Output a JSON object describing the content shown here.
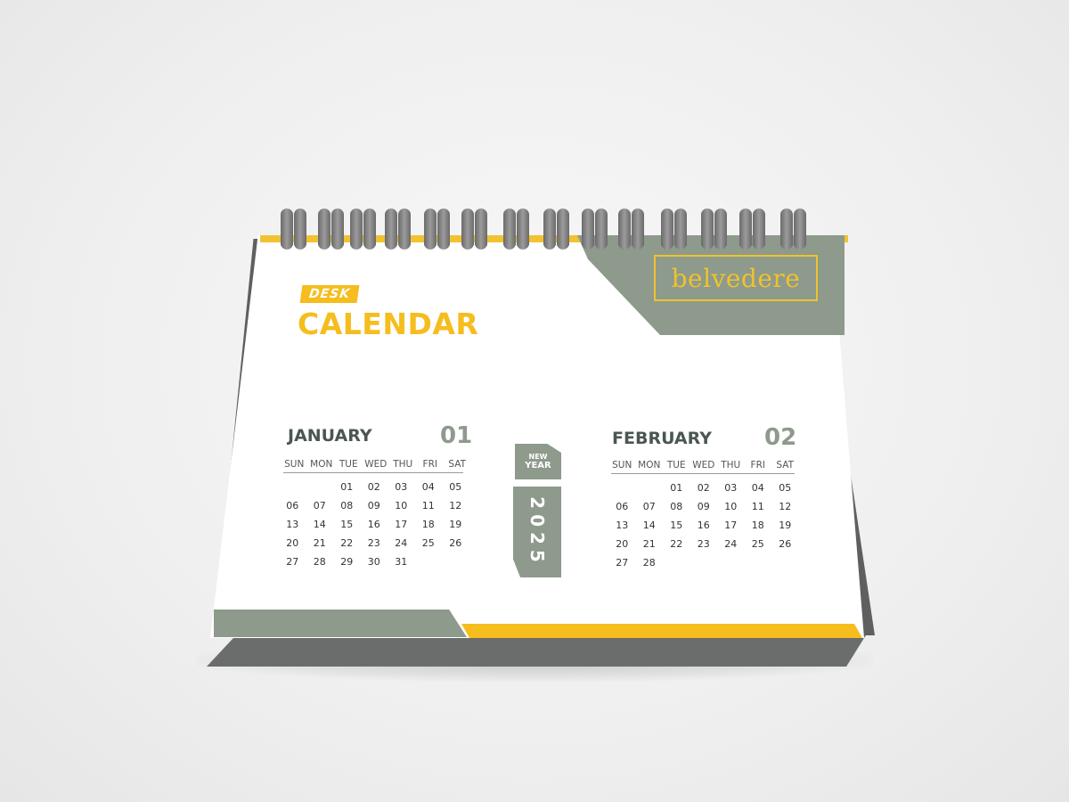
{
  "brand": {
    "logo_text": "belvedere"
  },
  "header": {
    "desk_label": "DESK",
    "title": "CALENDAR"
  },
  "center": {
    "new_label": "NEW",
    "year_label": "YEAR",
    "year": "2025"
  },
  "weekdays": [
    "SUN",
    "MON",
    "TUE",
    "WED",
    "THU",
    "FRI",
    "SAT"
  ],
  "months": [
    {
      "name": "JANUARY",
      "number": "01",
      "days": [
        "",
        "",
        "01",
        "02",
        "03",
        "04",
        "05",
        "06",
        "07",
        "08",
        "09",
        "10",
        "11",
        "12",
        "13",
        "14",
        "15",
        "16",
        "17",
        "18",
        "19",
        "20",
        "21",
        "22",
        "23",
        "24",
        "25",
        "26",
        "27",
        "28",
        "29",
        "30",
        "31",
        "",
        ""
      ]
    },
    {
      "name": "FEBRUARY",
      "number": "02",
      "days": [
        "",
        "",
        "01",
        "02",
        "03",
        "04",
        "05",
        "06",
        "07",
        "08",
        "09",
        "10",
        "11",
        "12",
        "13",
        "14",
        "15",
        "16",
        "17",
        "18",
        "19",
        "20",
        "21",
        "22",
        "23",
        "24",
        "25",
        "26",
        "27",
        "28",
        "",
        "",
        "",
        "",
        ""
      ]
    }
  ],
  "colors": {
    "accent_yellow": "#f5bd1d",
    "sage_green": "#8d9a8c",
    "text_dark": "#4b5651"
  }
}
